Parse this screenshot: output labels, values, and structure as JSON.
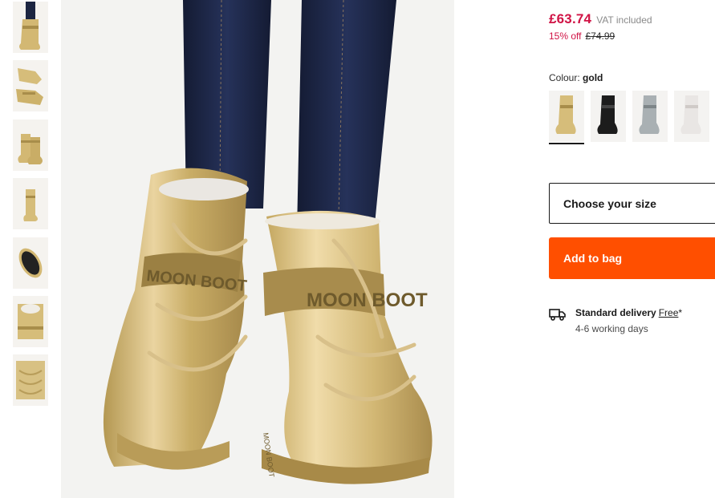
{
  "product": {
    "price": "£63.74",
    "vat_note": "VAT included",
    "discount": "15% off",
    "was_price": "£74.99"
  },
  "colour": {
    "label": "Colour:",
    "value": "gold",
    "swatches": [
      "gold",
      "black",
      "silver",
      "white"
    ]
  },
  "size_select": {
    "placeholder": "Choose your size"
  },
  "add_to_bag": {
    "label": "Add to bag"
  },
  "delivery": {
    "title": "Standard delivery",
    "free_label": "Free",
    "asterisk": "*",
    "time": "4-6 working days"
  },
  "hero_image": {
    "brand_text_left": "MOON BOOT",
    "brand_text_right": "MOON BOOT",
    "sole_text": "MOON BOOT"
  },
  "thumbnails": [
    "front-view",
    "pair-lying",
    "pair-side",
    "single-side",
    "sole-view",
    "top-view",
    "detail-view"
  ],
  "colors": {
    "price_red": "#d01345",
    "cta_orange": "#ff4f00",
    "gold": "#d6bd7a",
    "denim": "#1c2541"
  }
}
